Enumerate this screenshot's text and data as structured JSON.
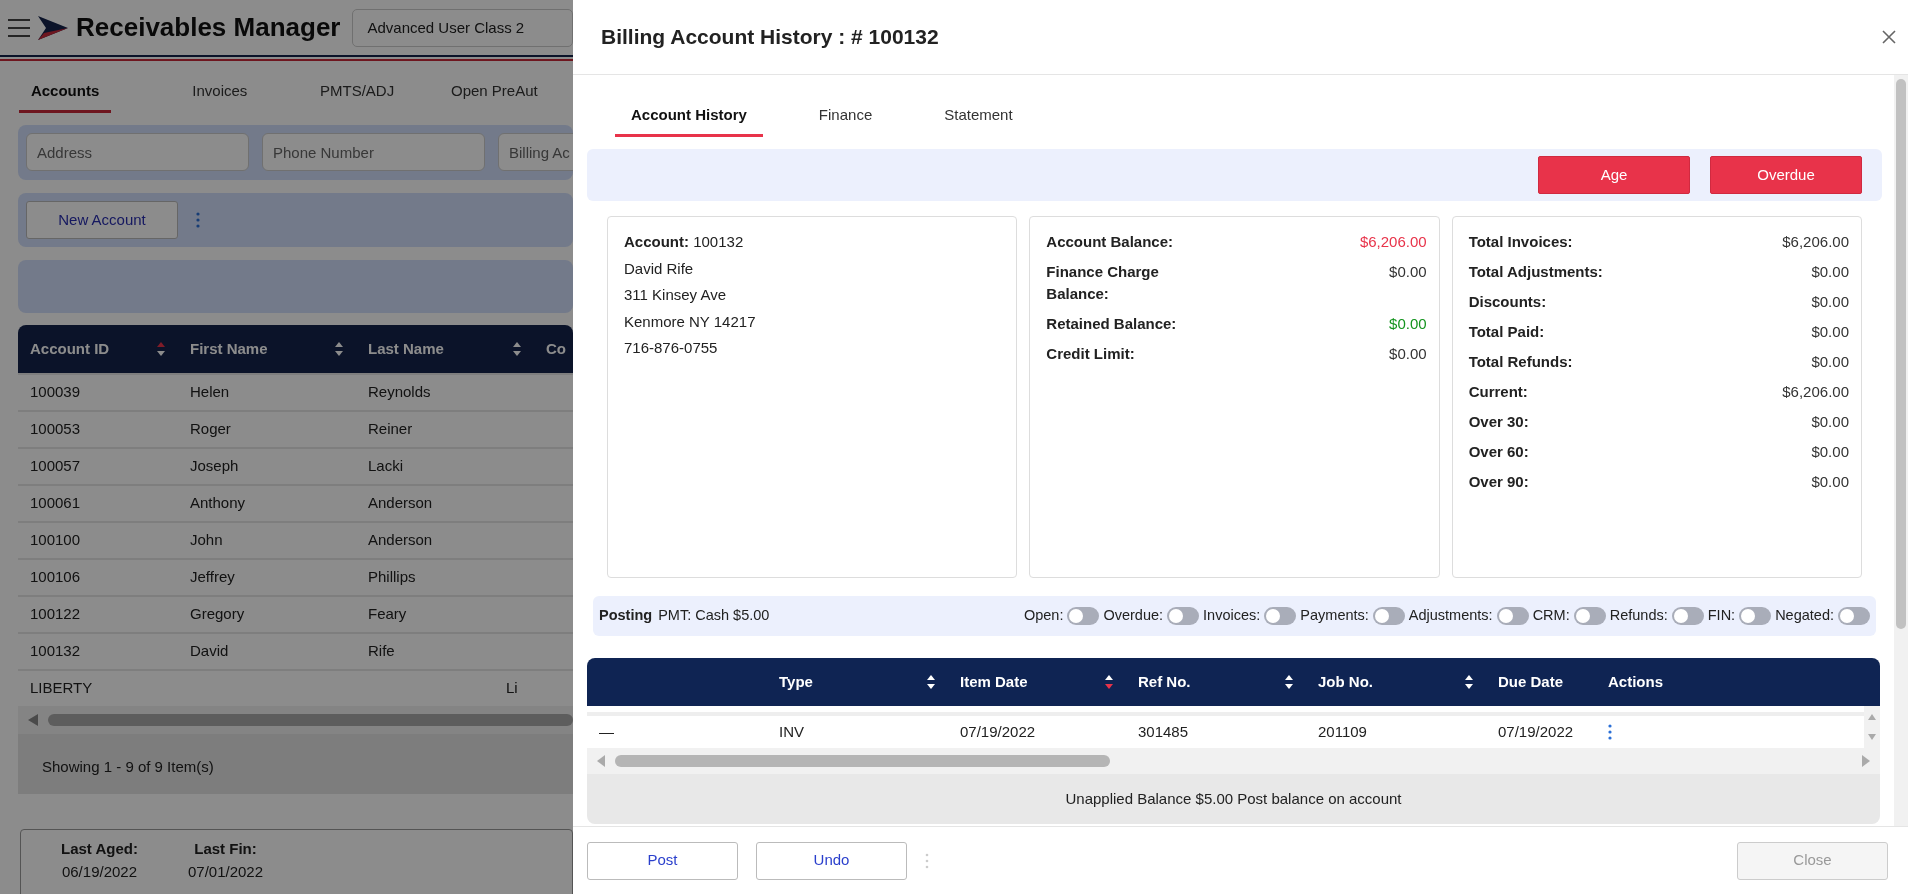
{
  "app": {
    "title": "Receivables Manager",
    "user_class": "Advanced User Class 2",
    "tabs": [
      {
        "label": "Accounts",
        "selected": true
      },
      {
        "label": "Invoices",
        "selected": false
      },
      {
        "label": "PMTS/ADJ",
        "selected": false
      },
      {
        "label": "Open PreAut",
        "selected": false
      }
    ],
    "filters": [
      {
        "placeholder": "Address"
      },
      {
        "placeholder": "Phone Number"
      },
      {
        "placeholder": "Billing Ac"
      }
    ],
    "new_account_button": "New Account",
    "accounts_table": {
      "columns": [
        {
          "label": "Account ID",
          "sortable": true,
          "sorted_asc": true,
          "sorted_desc": false
        },
        {
          "label": "First Name",
          "sortable": true,
          "sorted_asc": false,
          "sorted_desc": false
        },
        {
          "label": "Last Name",
          "sortable": true,
          "sorted_asc": false,
          "sorted_desc": false
        },
        {
          "label": "Co",
          "sortable": false
        }
      ],
      "rows": [
        [
          "100039",
          "Helen",
          "Reynolds"
        ],
        [
          "100053",
          "Roger",
          "Reiner"
        ],
        [
          "100057",
          "Joseph",
          "Lacki"
        ],
        [
          "100061",
          "Anthony",
          "Anderson"
        ],
        [
          "100100",
          "John",
          "Anderson"
        ],
        [
          "100106",
          "Jeffrey",
          "Phillips"
        ],
        [
          "100122",
          "Gregory",
          "Feary"
        ],
        [
          "100132",
          "David",
          "Rife"
        ]
      ],
      "footer_row": [
        "LIBERTY",
        "Li"
      ],
      "pager": "Showing 1 - 9 of 9 Item(s)"
    },
    "summary": [
      {
        "label": "Last Aged:",
        "value": "06/19/2022"
      },
      {
        "label": "Last Fin:",
        "value": "07/01/2022"
      }
    ]
  },
  "modal": {
    "title": "Billing Account History : # 100132",
    "tabs": [
      {
        "label": "Account History",
        "selected": true
      },
      {
        "label": "Finance",
        "selected": false
      },
      {
        "label": "Statement",
        "selected": false
      }
    ],
    "action_buttons": [
      "Age",
      "Overdue"
    ],
    "account": {
      "label": "Account:",
      "number": "100132",
      "lines": [
        "David Rife",
        "311 Kinsey Ave",
        "Kenmore NY 14217",
        "716-876-0755"
      ]
    },
    "balances": [
      {
        "label": "Account Balance:",
        "value": "$6,206.00",
        "color": "#e8334a"
      },
      {
        "label": "Finance Charge Balance:",
        "value": "$0.00",
        "color": "#333333"
      },
      {
        "label": "Retained Balance:",
        "value": "$0.00",
        "color": "#14941e"
      },
      {
        "label": "Credit Limit:",
        "value": "$0.00",
        "color": "#333333"
      }
    ],
    "totals": [
      {
        "label": "Total Invoices:",
        "value": "$6,206.00"
      },
      {
        "label": "Total Adjustments:",
        "value": "$0.00"
      },
      {
        "label": "Discounts:",
        "value": "$0.00"
      },
      {
        "label": "Total Paid:",
        "value": "$0.00"
      },
      {
        "label": "Total Refunds:",
        "value": "$0.00"
      },
      {
        "label": "Current:",
        "value": "$6,206.00"
      },
      {
        "label": "Over 30:",
        "value": "$0.00"
      },
      {
        "label": "Over 60:",
        "value": "$0.00"
      },
      {
        "label": "Over 90:",
        "value": "$0.00"
      }
    ],
    "posting": {
      "label": "Posting",
      "detail": "PMT: Cash $5.00",
      "toggles": [
        {
          "label": "Open:",
          "on": false
        },
        {
          "label": "Overdue:",
          "on": false
        },
        {
          "label": "Invoices:",
          "on": false
        },
        {
          "label": "Payments:",
          "on": false
        },
        {
          "label": "Adjustments:",
          "on": false
        },
        {
          "label": "CRM:",
          "on": false
        },
        {
          "label": "Refunds:",
          "on": false
        },
        {
          "label": "FIN:",
          "on": false
        },
        {
          "label": "Negated:",
          "on": false
        }
      ]
    },
    "history_table": {
      "columns": [
        {},
        {
          "label": "Type",
          "sortable": true,
          "sorted_asc": false,
          "sorted_desc": false
        },
        {
          "label": "Item Date",
          "sortable": true,
          "sorted_asc": false,
          "sorted_desc": true
        },
        {
          "label": "Ref No.",
          "sortable": true,
          "sorted_asc": false,
          "sorted_desc": false
        },
        {
          "label": "Job No.",
          "sortable": true,
          "sorted_asc": false,
          "sorted_desc": false
        },
        {
          "label": "Due Date",
          "sortable": false
        },
        {
          "label": "Actions",
          "sortable": false
        }
      ],
      "rows": [
        [
          "—",
          "INV",
          "07/19/2022",
          "301485",
          "201109",
          "07/19/2022"
        ]
      ],
      "footer": "Unapplied Balance $5.00 Post balance on account"
    },
    "buttons": [
      {
        "label": "Post",
        "disabled": false
      },
      {
        "label": "Undo",
        "disabled": false
      }
    ],
    "close_button": {
      "label": "Close",
      "disabled": true
    }
  }
}
